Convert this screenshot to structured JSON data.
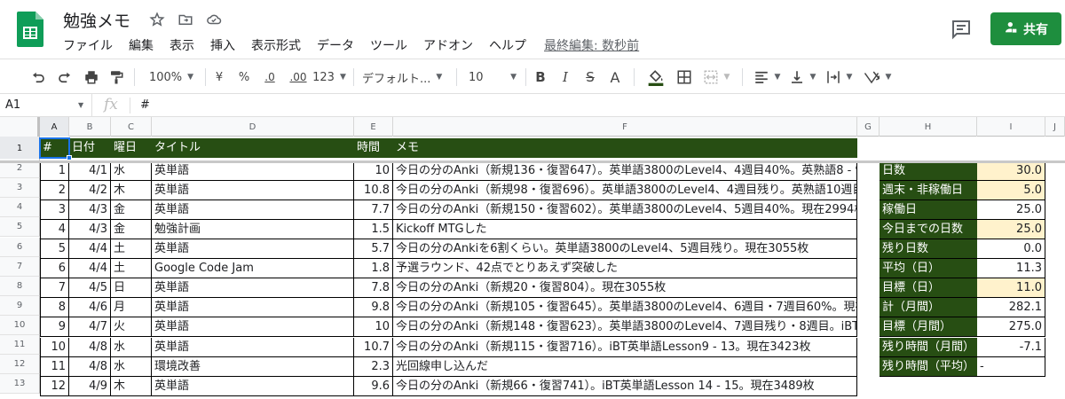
{
  "doc": {
    "title": "勉強メモ",
    "last_edit": "最終編集: 数秒前",
    "share_label": "共有"
  },
  "menu": [
    "ファイル",
    "編集",
    "表示",
    "挿入",
    "表示形式",
    "データ",
    "ツール",
    "アドオン",
    "ヘルプ"
  ],
  "toolbar": {
    "zoom": "100%",
    "currency": "¥",
    "percent": "%",
    "decimal_decrease": ".0",
    "decimal_increase": ".00",
    "more_formats": "123",
    "font": "デフォルト...",
    "font_size": "10",
    "bold": "B",
    "italic": "I",
    "strike": "S",
    "text_color": "A"
  },
  "formula_bar": {
    "cell": "A1",
    "value": "#"
  },
  "colors": {
    "header_green": "#274e13",
    "highlight": "#fff2cc",
    "share_green": "#1e8e3e",
    "selection": "#1a73e8"
  },
  "columns": [
    "A",
    "B",
    "C",
    "D",
    "E",
    "F",
    "G",
    "H",
    "I",
    "J"
  ],
  "row_numbers": [
    "1",
    "2",
    "3",
    "4",
    "5",
    "6",
    "7",
    "8",
    "9",
    "10",
    "11",
    "12",
    "13"
  ],
  "table": {
    "headers": [
      "#",
      "日付",
      "曜日",
      "タイトル",
      "時間",
      "メモ"
    ],
    "rows": [
      [
        "1",
        "4/1",
        "水",
        "英単語",
        "10",
        "今日の分のAnki（新規136・復習647）。英単語3800のLevel4、4週目40%。英熟語8 - 9"
      ],
      [
        "2",
        "4/2",
        "木",
        "英単語",
        "10.8",
        "今日の分のAnki（新規98・復習696）。英単語3800のLevel4、4週目残り。英熟語10週目"
      ],
      [
        "3",
        "4/3",
        "金",
        "英単語",
        "7.7",
        "今日の分のAnki（新規150・復習602）。英単語3800のLevel4、5週目40%。現在2994枚"
      ],
      [
        "4",
        "4/3",
        "金",
        "勉強計画",
        "1.5",
        "Kickoff MTGした"
      ],
      [
        "5",
        "4/4",
        "土",
        "英単語",
        "5.7",
        "今日の分のAnkiを6割くらい。英単語3800のLevel4、5週目残り。現在3055枚"
      ],
      [
        "6",
        "4/4",
        "土",
        "Google Code Jam",
        "1.8",
        "予選ラウンド、42点でとりあえず突破した"
      ],
      [
        "7",
        "4/5",
        "日",
        "英単語",
        "7.8",
        "今日の分のAnki（新規20・復習804）。現在3055枚"
      ],
      [
        "8",
        "4/6",
        "月",
        "英単語",
        "9.8",
        "今日の分のAnki（新規105・復習645）。英単語3800のLevel4、6週目・7週目60%。現在"
      ],
      [
        "9",
        "4/7",
        "火",
        "英単語",
        "10",
        "今日の分のAnki（新規148・復習623）。英単語3800のLevel4、7週目残り・8週目。iBT"
      ],
      [
        "10",
        "4/8",
        "水",
        "英単語",
        "10.7",
        "今日の分のAnki（新規115・復習716）。iBT英単語Lesson9 - 13。現在3423枚"
      ],
      [
        "11",
        "4/8",
        "水",
        "環境改善",
        "2.3",
        "光回線申し込んだ"
      ],
      [
        "12",
        "4/9",
        "木",
        "英単語",
        "9.6",
        "今日の分のAnki（新規66・復習741）。iBT英単語Lesson 14 - 15。現在3489枚"
      ]
    ]
  },
  "summary": [
    {
      "label": "日数",
      "value": "30.0",
      "highlight": true
    },
    {
      "label": "週末・非稼働日",
      "value": "5.0",
      "highlight": true
    },
    {
      "label": "稼働日",
      "value": "25.0",
      "highlight": false
    },
    {
      "label": "今日までの日数",
      "value": "25.0",
      "highlight": true
    },
    {
      "label": "残り日数",
      "value": "0.0",
      "highlight": false
    },
    {
      "label": "平均（日）",
      "value": "11.3",
      "highlight": false
    },
    {
      "label": "目標（日）",
      "value": "11.0",
      "highlight": true
    },
    {
      "label": "計（月間）",
      "value": "282.1",
      "highlight": false
    },
    {
      "label": "目標（月間）",
      "value": "275.0",
      "highlight": false
    },
    {
      "label": "残り時間（月間）",
      "value": "-7.1",
      "highlight": false
    },
    {
      "label": "残り時間（平均）",
      "value": "-",
      "highlight": false
    }
  ]
}
